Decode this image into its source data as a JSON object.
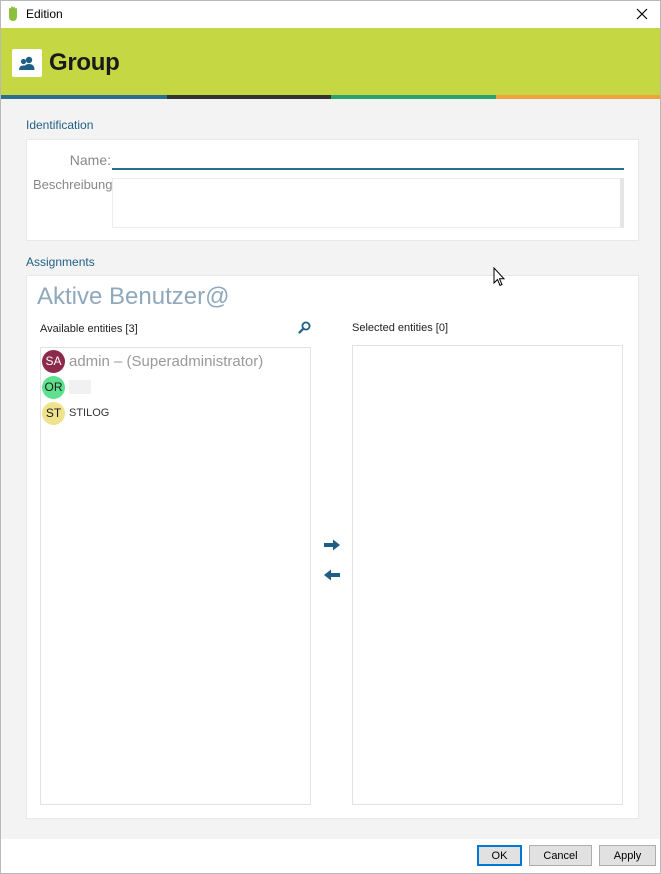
{
  "window": {
    "title": "Edition",
    "close_glyph": "✕"
  },
  "banner": {
    "title": "Group",
    "icon": "user-group-icon",
    "background": "#c5d843",
    "stripe_colors": [
      "#2b6f8f",
      "#333333",
      "#2aa36b",
      "#f0a23c"
    ]
  },
  "identification": {
    "section_label": "Identification",
    "name_label": "Name:",
    "name_value": "",
    "description_label": "Beschreibung:",
    "description_value": ""
  },
  "assignments": {
    "section_label": "Assignments",
    "title": "Aktive Benutzer@",
    "available_header": "Available entities [3]",
    "selected_header": "Selected entities [0]",
    "available": [
      {
        "initials": "SA",
        "name": "admin – (Superadministrator)",
        "avatar_bg": "#8b2a4a",
        "avatar_fg": "#ffffff"
      },
      {
        "initials": "OR",
        "name": "",
        "avatar_bg": "#5fe08f",
        "avatar_fg": "#1a1a1a"
      },
      {
        "initials": "ST",
        "name": "STILOG",
        "avatar_bg": "#efe28c",
        "avatar_fg": "#1a1a1a"
      }
    ],
    "selected": [],
    "add_icon": "arrow-right-icon",
    "remove_icon": "arrow-left-icon",
    "search_icon": "search-icon"
  },
  "footer": {
    "ok_label": "OK",
    "cancel_label": "Cancel",
    "apply_label": "Apply"
  }
}
